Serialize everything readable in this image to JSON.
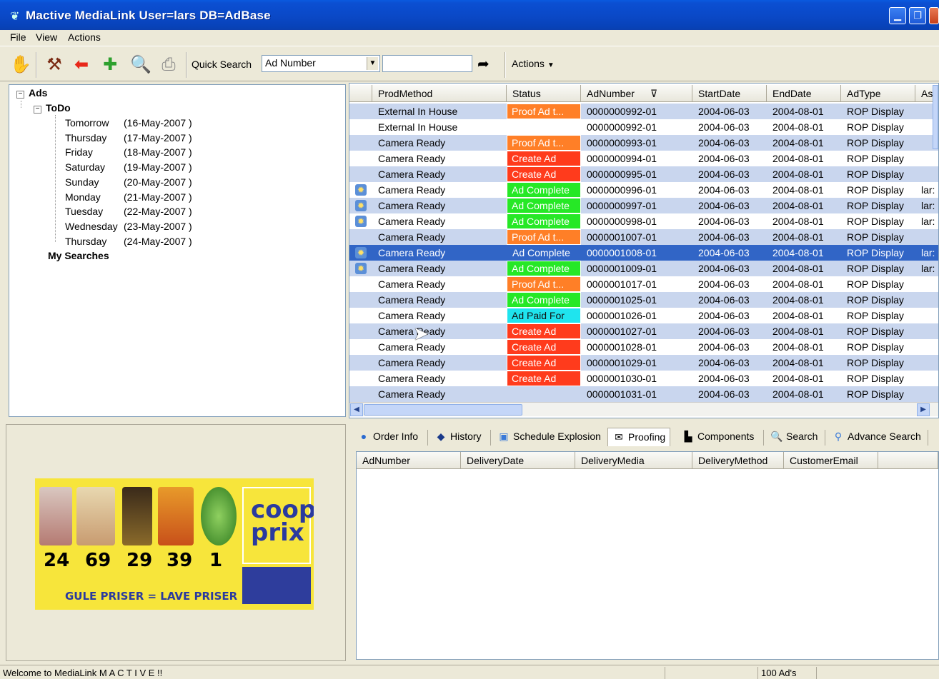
{
  "window": {
    "title": "Mactive MediaLink   User=lars   DB=AdBase",
    "title_bg": "#0b4fd2"
  },
  "menu": [
    "File",
    "View",
    "Actions"
  ],
  "toolbar": {
    "quick_search_label": "Quick Search",
    "quick_search_field": "Ad Number",
    "quick_search_value": "",
    "actions_label": "Actions"
  },
  "tree": {
    "root": "Ads",
    "todo": "ToDo",
    "days": [
      {
        "day": "Tomorrow",
        "date": "(16-May-2007 )"
      },
      {
        "day": "Thursday",
        "date": "(17-May-2007 )"
      },
      {
        "day": "Friday",
        "date": "(18-May-2007 )"
      },
      {
        "day": "Saturday",
        "date": "(19-May-2007 )"
      },
      {
        "day": "Sunday",
        "date": "(20-May-2007 )"
      },
      {
        "day": "Monday",
        "date": "(21-May-2007 )"
      },
      {
        "day": "Tuesday",
        "date": "(22-May-2007 )"
      },
      {
        "day": "Wednesday",
        "date": "(23-May-2007 )"
      },
      {
        "day": "Thursday",
        "date": "(24-May-2007 )"
      }
    ],
    "my_searches": "My Searches"
  },
  "preview": {
    "brand": "coop prix",
    "slogan": "GULE PRISER = LAVE PRISER",
    "prices": [
      "24",
      "69",
      "29",
      "39",
      "1"
    ]
  },
  "grid": {
    "columns": [
      "ProdMethod",
      "Status",
      "AdNumber",
      "StartDate",
      "EndDate",
      "AdType",
      "As"
    ],
    "rows": [
      {
        "icon": false,
        "prod": "External In House",
        "status": "Proof Ad t...",
        "st": "proof",
        "ad": "0000000992-01",
        "start": "2004-06-03",
        "end": "2004-08-01",
        "type": "ROP Display",
        "as": ""
      },
      {
        "icon": false,
        "prod": "External In House",
        "status": "",
        "st": "",
        "ad": "0000000992-01",
        "start": "2004-06-03",
        "end": "2004-08-01",
        "type": "ROP Display",
        "as": ""
      },
      {
        "icon": false,
        "prod": "Camera Ready",
        "status": "Proof Ad t...",
        "st": "proof",
        "ad": "0000000993-01",
        "start": "2004-06-03",
        "end": "2004-08-01",
        "type": "ROP Display",
        "as": ""
      },
      {
        "icon": false,
        "prod": "Camera Ready",
        "status": "Create Ad",
        "st": "create",
        "ad": "0000000994-01",
        "start": "2004-06-03",
        "end": "2004-08-01",
        "type": "ROP Display",
        "as": ""
      },
      {
        "icon": false,
        "prod": "Camera Ready",
        "status": "Create Ad",
        "st": "create",
        "ad": "0000000995-01",
        "start": "2004-06-03",
        "end": "2004-08-01",
        "type": "ROP Display",
        "as": ""
      },
      {
        "icon": true,
        "prod": "Camera Ready",
        "status": "Ad Complete",
        "st": "complete",
        "ad": "0000000996-01",
        "start": "2004-06-03",
        "end": "2004-08-01",
        "type": "ROP Display",
        "as": "lar:"
      },
      {
        "icon": true,
        "prod": "Camera Ready",
        "status": "Ad Complete",
        "st": "complete",
        "ad": "0000000997-01",
        "start": "2004-06-03",
        "end": "2004-08-01",
        "type": "ROP Display",
        "as": "lar:"
      },
      {
        "icon": true,
        "prod": "Camera Ready",
        "status": "Ad Complete",
        "st": "complete",
        "ad": "0000000998-01",
        "start": "2004-06-03",
        "end": "2004-08-01",
        "type": "ROP Display",
        "as": "lar:"
      },
      {
        "icon": false,
        "prod": "Camera Ready",
        "status": "Proof Ad t...",
        "st": "proof",
        "ad": "0000001007-01",
        "start": "2004-06-03",
        "end": "2004-08-01",
        "type": "ROP Display",
        "as": ""
      },
      {
        "icon": true,
        "prod": "Camera Ready",
        "status": "Ad Complete",
        "st": "selected",
        "ad": "0000001008-01",
        "start": "2004-06-03",
        "end": "2004-08-01",
        "type": "ROP Display",
        "as": "lar:"
      },
      {
        "icon": true,
        "prod": "Camera Ready",
        "status": "Ad Complete",
        "st": "complete",
        "ad": "0000001009-01",
        "start": "2004-06-03",
        "end": "2004-08-01",
        "type": "ROP Display",
        "as": "lar:"
      },
      {
        "icon": false,
        "prod": "Camera Ready",
        "status": "Proof Ad t...",
        "st": "proof",
        "ad": "0000001017-01",
        "start": "2004-06-03",
        "end": "2004-08-01",
        "type": "ROP Display",
        "as": ""
      },
      {
        "icon": false,
        "prod": "Camera Ready",
        "status": "Ad Complete",
        "st": "complete",
        "ad": "0000001025-01",
        "start": "2004-06-03",
        "end": "2004-08-01",
        "type": "ROP Display",
        "as": ""
      },
      {
        "icon": false,
        "prod": "Camera Ready",
        "status": "Ad Paid For",
        "st": "paid",
        "ad": "0000001026-01",
        "start": "2004-06-03",
        "end": "2004-08-01",
        "type": "ROP Display",
        "as": ""
      },
      {
        "icon": false,
        "prod": "Camera Ready",
        "status": "Create Ad",
        "st": "create",
        "ad": "0000001027-01",
        "start": "2004-06-03",
        "end": "2004-08-01",
        "type": "ROP Display",
        "as": ""
      },
      {
        "icon": false,
        "prod": "Camera Ready",
        "status": "Create Ad",
        "st": "create",
        "ad": "0000001028-01",
        "start": "2004-06-03",
        "end": "2004-08-01",
        "type": "ROP Display",
        "as": ""
      },
      {
        "icon": false,
        "prod": "Camera Ready",
        "status": "Create Ad",
        "st": "create",
        "ad": "0000001029-01",
        "start": "2004-06-03",
        "end": "2004-08-01",
        "type": "ROP Display",
        "as": ""
      },
      {
        "icon": false,
        "prod": "Camera Ready",
        "status": "Create Ad",
        "st": "create",
        "ad": "0000001030-01",
        "start": "2004-06-03",
        "end": "2004-08-01",
        "type": "ROP Display",
        "as": ""
      },
      {
        "icon": false,
        "prod": "Camera Ready",
        "status": "",
        "st": "",
        "ad": "0000001031-01",
        "start": "2004-06-03",
        "end": "2004-08-01",
        "type": "ROP Display",
        "as": ""
      }
    ]
  },
  "tabs": [
    {
      "label": "Order Info",
      "icon": "info-icon"
    },
    {
      "label": "History",
      "icon": "book-icon"
    },
    {
      "label": "Schedule Explosion",
      "icon": "calendar-icon"
    },
    {
      "label": "Proofing",
      "icon": "envelope-icon",
      "active": true
    },
    {
      "label": "Components",
      "icon": "components-icon"
    },
    {
      "label": "Search",
      "icon": "magnifier-icon"
    },
    {
      "label": "Advance Search",
      "icon": "users-search-icon"
    }
  ],
  "detail_columns": [
    "AdNumber",
    "DeliveryDate",
    "DeliveryMedia",
    "DeliveryMethod",
    "CustomerEmail"
  ],
  "status_bar": {
    "message": "Welcome to MediaLink M A C T I V E !!",
    "count": "100 Ad's"
  },
  "colors": {
    "proof": "#ff7f27",
    "create": "#ff3b1c",
    "complete": "#26e826",
    "paid": "#1fe4ee",
    "selected": "#3165c6",
    "alt_row": "#c9d6ee"
  }
}
